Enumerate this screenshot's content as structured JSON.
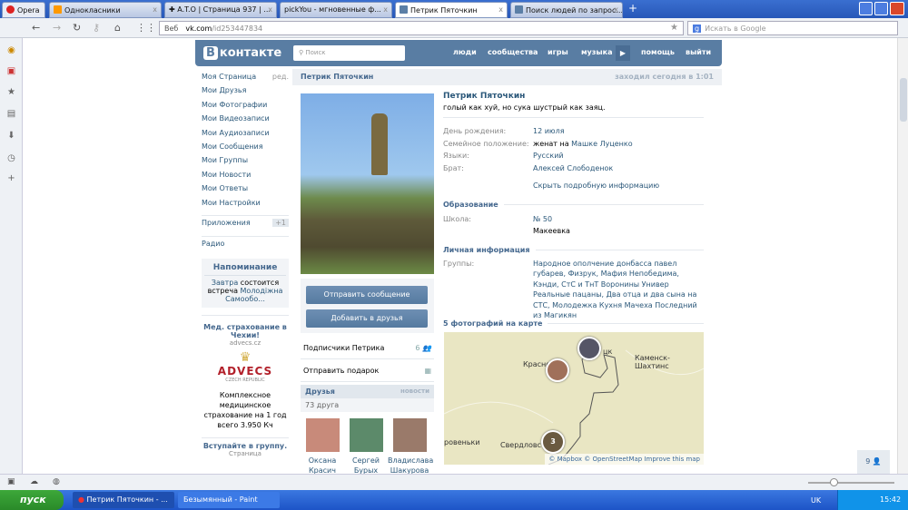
{
  "browser": {
    "opera_label": "Opera",
    "tabs": [
      {
        "title": "Однокласники"
      },
      {
        "title": "✚ A.T.O | Страница 937 | ..."
      },
      {
        "title": "pickYou - мгновенные ф..."
      },
      {
        "title": "Петрик Пяточкин"
      },
      {
        "title": "Поиск людей по запрос..."
      }
    ],
    "new_tab": "+",
    "veb_label": "Веб",
    "url_host": "vk.com",
    "url_path": "/id253447834",
    "search_placeholder": "Искать в Google",
    "close_label": "x"
  },
  "vk": {
    "logo": "ВКонтакте",
    "search_placeholder": "Поиск",
    "nav": [
      "люди",
      "сообщества",
      "игры",
      "музыка",
      "помощь",
      "выйти"
    ],
    "menu": [
      {
        "label": "Моя Страница",
        "extra": "ред."
      },
      {
        "label": "Мои Друзья"
      },
      {
        "label": "Мои Фотографии"
      },
      {
        "label": "Мои Видеозаписи"
      },
      {
        "label": "Мои Аудиозаписи"
      },
      {
        "label": "Мои Сообщения"
      },
      {
        "label": "Мои Группы"
      },
      {
        "label": "Мои Новости"
      },
      {
        "label": "Мои Ответы"
      },
      {
        "label": "Мои Настройки"
      }
    ],
    "apps": "Приложения",
    "apps_badge": "+1",
    "radio": "Радио",
    "reminder": {
      "title": "Напоминание",
      "t1": "Завтра",
      "t2": " состоится встреча ",
      "t3": "Молодіжна Самообо..."
    },
    "ad1": {
      "title": "Мед. страхование в Чехии!",
      "domain": "advecs.cz",
      "brand": "ADVECS",
      "brand_sub": "CZECH REPUBLIC",
      "text": "Комплексное медицинское страхование на 1 год всего 3.950 Кч"
    },
    "ad2": {
      "title": "Вступайте в группу.",
      "sub": "Страница"
    }
  },
  "profile": {
    "header_name": "Петрик Пяточкин",
    "last_seen": "заходил сегодня в 1:01",
    "name": "Петрик Пяточкин",
    "status": "голый как хуй, но сука шустрый как заяц.",
    "fields": [
      {
        "k": "День рождения:",
        "v": "12 июля"
      },
      {
        "k": "Семейное положение:",
        "v_pre": "женат на ",
        "v": "Машке Луценко"
      },
      {
        "k": "Языки:",
        "v": "Русский"
      },
      {
        "k": "Брат:",
        "v": "Алексей Слободенок"
      }
    ],
    "hide_info": "Скрыть подробную информацию",
    "edu_title": "Образование",
    "school_k": "Школа:",
    "school_v": "№ 50",
    "school_city": "Макеевка",
    "personal_title": "Личная информация",
    "groups_k": "Группы:",
    "groups_v": "Народное ополчение донбасса павел губарев, Физрук, Мафия Непобедима, Кэнди, СтС и ТнТ Воронины Универ Реальные пацаны, Два отца и два сына на СТС, Молодежка Кухня Мачеха Последний из Магикян",
    "map_title": "5 фотографий на карте",
    "map_labels": [
      "Красно",
      "цк",
      "Каменск-Шахтинс",
      "ровеньки",
      "Свердловс"
    ],
    "map_cluster": "3",
    "map_attrib": "© Mapbox © OpenStreetMap Improve this map",
    "send_message": "Отправить сообщение",
    "add_friend": "Добавить в друзья",
    "subscribers": "Подписчики Петрика",
    "subscribers_count": "6",
    "gift": "Отправить подарок",
    "friends_title": "Друзья",
    "friends_news": "новости",
    "friends_count": "73 друга",
    "friends": [
      {
        "first": "Оксана",
        "last": "Красич"
      },
      {
        "first": "Сергей",
        "last": "Бурых"
      },
      {
        "first": "Владислава",
        "last": "Шакурова"
      }
    ],
    "chat_count": "9"
  },
  "taskbar": {
    "start": "пуск",
    "items": [
      "Петрик Пяточкин - ...",
      "Безымянный - Paint"
    ],
    "lang": "UK",
    "time": "15:42"
  }
}
